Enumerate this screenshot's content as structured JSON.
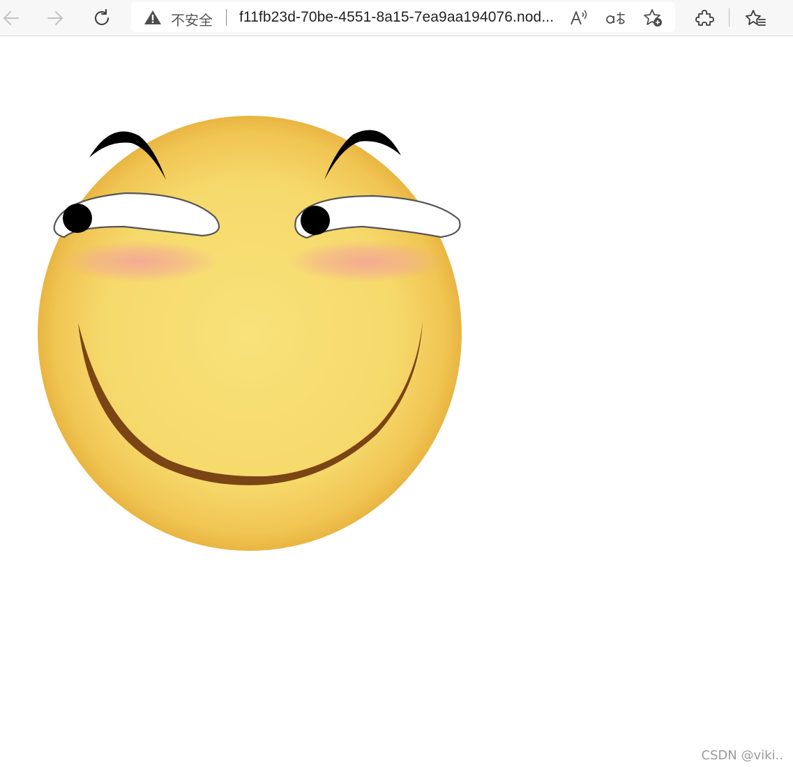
{
  "browser": {
    "back_icon": "arrow-left-icon",
    "forward_icon": "arrow-right-icon",
    "reload_icon": "refresh-icon",
    "security_label": "不安全",
    "url": "f11fb23d-70be-4551-8a15-7ea9aa194076.nod...",
    "read_aloud_icon": "read-aloud-icon",
    "translate_icon": "translate-icon",
    "favorite_add_icon": "star-add-icon",
    "extensions_icon": "puzzle-icon",
    "favorites_icon": "favorites-list-icon"
  },
  "page": {
    "image": "smirking-smiley-face",
    "colors": {
      "face": "#f6d96b",
      "face_edge": "#ecb846",
      "brow": "#000000",
      "pupil": "#000000",
      "mouth": "#7a4414",
      "blush": "#f3a29a"
    }
  },
  "watermark": "CSDN @viki.."
}
